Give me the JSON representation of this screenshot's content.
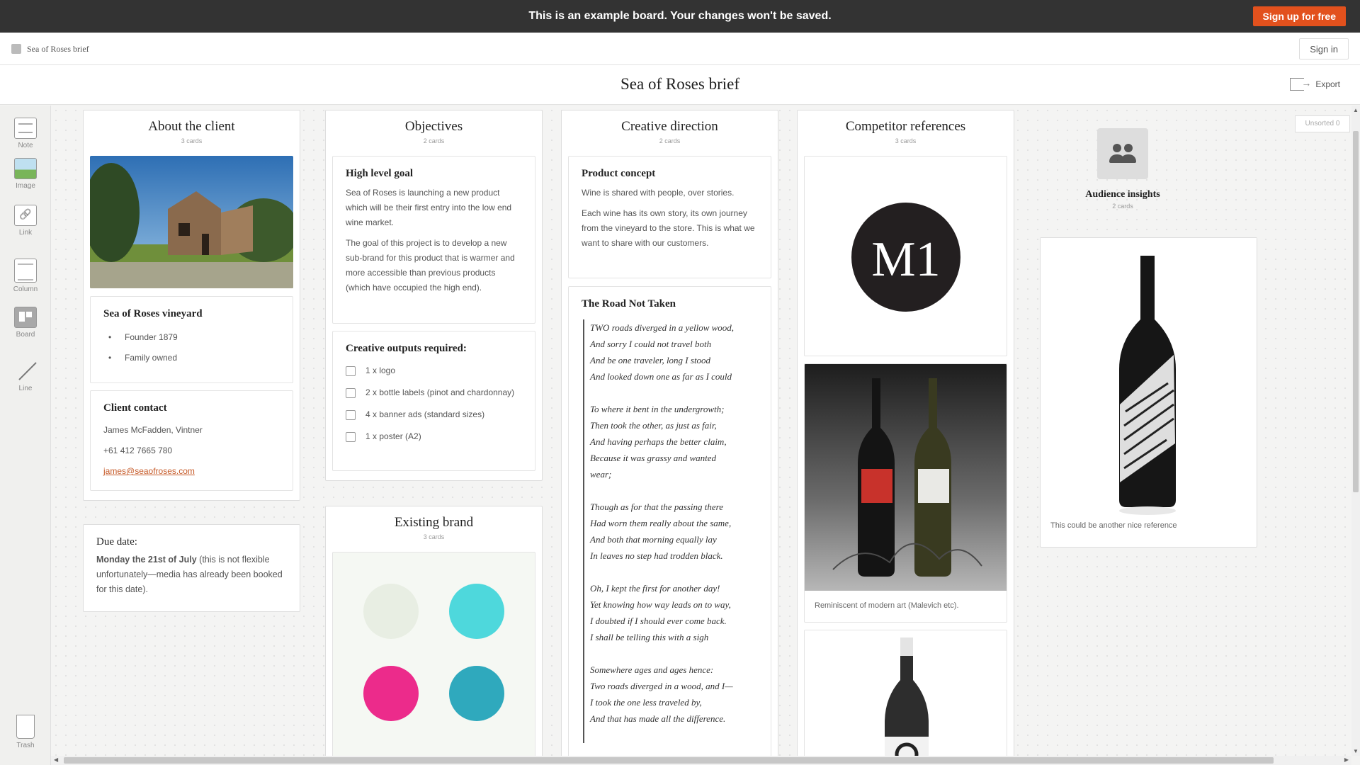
{
  "banner": {
    "text": "This is an example board. Your changes won't be saved.",
    "signup_label": "Sign up for free",
    "accent": "#e2511d"
  },
  "topbar": {
    "breadcrumb": "Sea of Roses brief",
    "signin_label": "Sign in"
  },
  "board": {
    "title": "Sea of Roses brief",
    "export_label": "Export"
  },
  "toolbar": {
    "note": "Note",
    "image": "Image",
    "link": "Link",
    "column": "Column",
    "board": "Board",
    "line": "Line",
    "trash": "Trash"
  },
  "columns": {
    "about": {
      "title": "About the client",
      "count": "3 cards",
      "vineyard": {
        "title": "Sea of Roses vineyard",
        "items": [
          "Founder 1879",
          "Family owned"
        ]
      },
      "contact": {
        "title": "Client contact",
        "name": "James McFadden, Vintner",
        "phone": "+61 412 7665 780",
        "email": "james@seaofroses.com"
      }
    },
    "due": {
      "title": "Due date:",
      "bold": "Monday the 21st of July",
      "rest": " (this is not flexible unfortunately—media has already been booked for this date)."
    },
    "objectives": {
      "title": "Objectives",
      "count": "2 cards",
      "goal": {
        "title": "High level goal",
        "p1": "Sea of Roses is launching a new product which will be their first entry into the low end wine market.",
        "p2": "The goal of this project is to develop a new sub-brand for this product that is warmer and more accessible than previous products (which have occupied the high end)."
      },
      "outputs": {
        "title": "Creative outputs required:",
        "items": [
          "1 x logo",
          "2 x bottle labels (pinot and chardonnay)",
          "4 x banner ads (standard sizes)",
          "1 x poster (A2)"
        ]
      }
    },
    "existing": {
      "title": "Existing brand",
      "count": "3 cards",
      "swatches": [
        "#e8eee3",
        "#4ed8dc",
        "#ec2b8b",
        "#2fa9bd"
      ]
    },
    "creative": {
      "title": "Creative direction",
      "count": "2 cards",
      "concept": {
        "title": "Product concept",
        "p1": "Wine is shared with people, over stories.",
        "p2": "Each wine has its own story, its own journey from the vineyard to the store. This is what we want to share with our customers."
      },
      "poem": {
        "title": "The Road Not Taken",
        "stanzas": [
          [
            "TWO roads diverged in a yellow wood,",
            "And sorry I could not travel both",
            "And be one traveler, long I stood",
            "And looked down one as far as I could"
          ],
          [
            "To where it bent in the undergrowth;",
            "Then took the other, as just as fair,",
            "And having perhaps the better claim,",
            "Because it was grassy and wanted",
            "wear;"
          ],
          [
            "Though as for that the passing there",
            "Had worn them really about the same,",
            "And both that morning equally lay",
            "In leaves no step had trodden black."
          ],
          [
            "Oh, I kept the first for another day!",
            "Yet knowing how way leads on to way,",
            "I doubted if I should ever come back.",
            "I shall be telling this with a sigh"
          ],
          [
            "Somewhere ages and ages hence:",
            "Two roads diverged in a wood, and I—",
            "I took the one less traveled by,",
            "And that has made all the difference."
          ]
        ]
      }
    },
    "competitor": {
      "title": "Competitor references",
      "count": "3 cards",
      "logo_text": "M1",
      "caption": "Reminiscent of modern art (Malevich etc)."
    },
    "reference": {
      "caption": "This could be another nice reference"
    }
  },
  "unsorted": "Unsorted 0",
  "audience": {
    "title": "Audience insights",
    "count": "2 cards"
  }
}
